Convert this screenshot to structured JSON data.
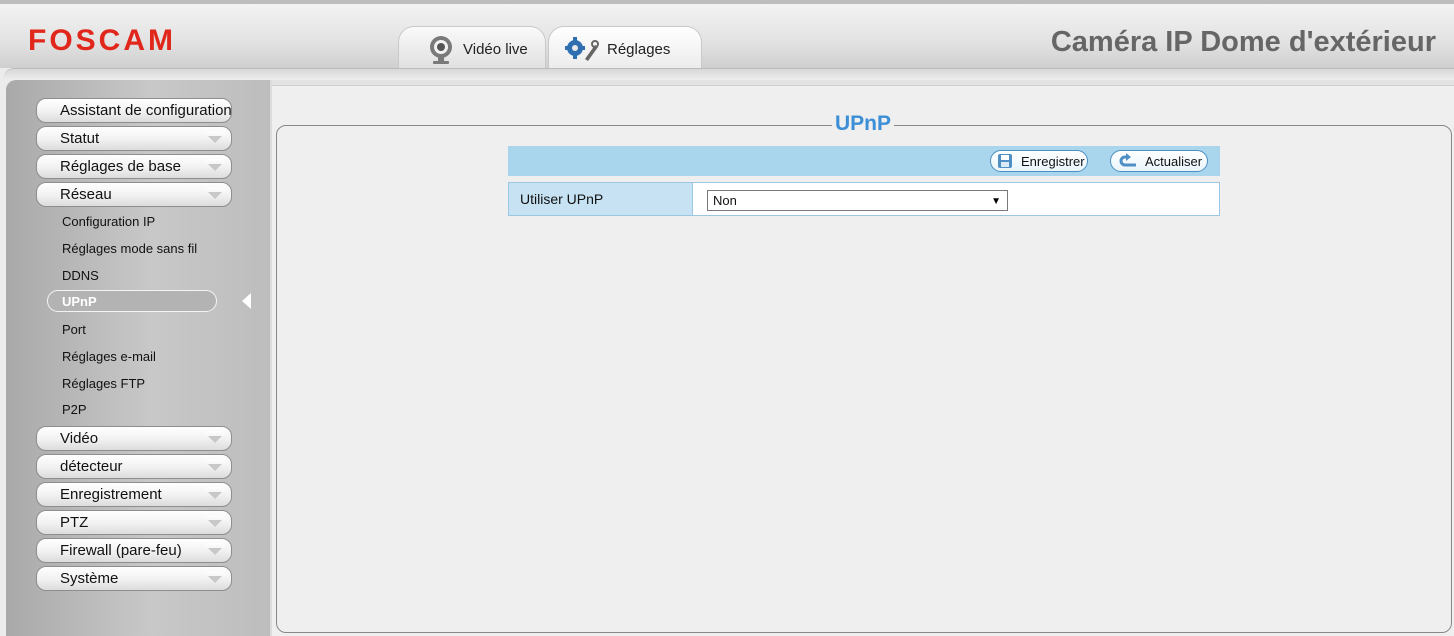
{
  "header": {
    "logo": "FOSCAM",
    "product_title": "Caméra IP Dome d'extérieur",
    "tabs": [
      {
        "label": "Vidéo live",
        "icon": "webcam-icon"
      },
      {
        "label": "Réglages",
        "icon": "gears-wrench-icon"
      }
    ]
  },
  "sidebar": {
    "menus_top": [
      {
        "label": "Assistant de configuration"
      },
      {
        "label": "Statut"
      },
      {
        "label": "Réglages de base"
      },
      {
        "label": "Réseau"
      }
    ],
    "network_items": [
      {
        "label": "Configuration IP"
      },
      {
        "label": "Réglages mode sans fil"
      },
      {
        "label": "DDNS"
      },
      {
        "label": "UPnP",
        "active": true
      },
      {
        "label": "Port"
      },
      {
        "label": "Réglages e-mail"
      },
      {
        "label": "Réglages FTP"
      },
      {
        "label": "P2P"
      }
    ],
    "menus_bottom": [
      {
        "label": "Vidéo"
      },
      {
        "label": "détecteur"
      },
      {
        "label": "Enregistrement"
      },
      {
        "label": "PTZ"
      },
      {
        "label": "Firewall (pare-feu)"
      },
      {
        "label": "Système"
      }
    ]
  },
  "main": {
    "title": "UPnP",
    "toolbar": {
      "save_label": "Enregistrer",
      "refresh_label": "Actualiser"
    },
    "form": {
      "use_upnp_label": "Utiliser UPnP",
      "use_upnp_value": "Non"
    }
  },
  "colors": {
    "logo": "#e1271c",
    "title_accent": "#3c8fd6",
    "toolbar_bg": "#a9d6ec",
    "label_bg": "#c6e2f3"
  }
}
